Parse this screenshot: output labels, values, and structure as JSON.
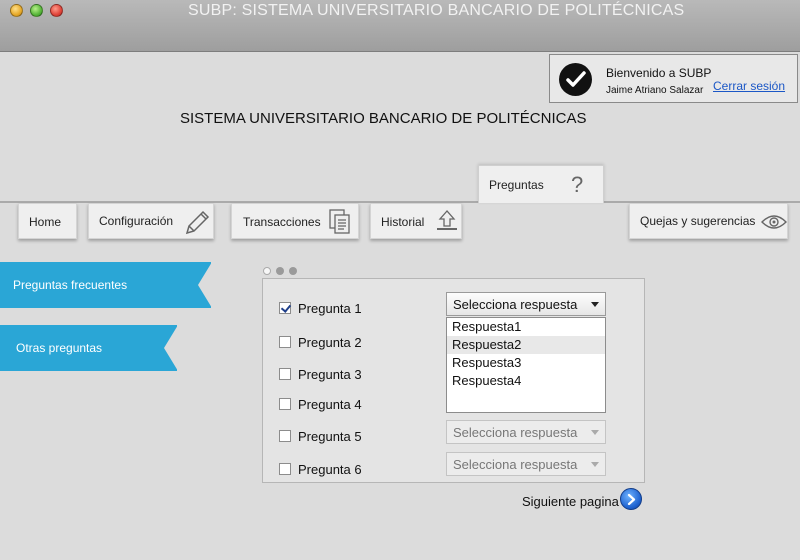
{
  "window": {
    "title": "SUBP: SISTEMA UNIVERSITARIO BANCARIO DE POLITÉCNICAS"
  },
  "welcome": {
    "title": "Bienvenido a SUBP",
    "user": "Jaime Atriano Salazar",
    "logout": "Cerrar sesión"
  },
  "heading": "SISTEMA UNIVERSITARIO BANCARIO DE POLITÉCNICAS",
  "nav": {
    "active_tab": "Preguntas",
    "items": [
      "Home",
      "Configuración",
      "Transacciones",
      "Historial",
      "Quejas y sugerencias"
    ]
  },
  "sidebar": {
    "items": [
      "Preguntas frecuentes",
      "Otras preguntas"
    ]
  },
  "questions": {
    "items": [
      {
        "label": "Pregunta 1",
        "checked": true
      },
      {
        "label": "Pregunta 2",
        "checked": false
      },
      {
        "label": "Pregunta 3",
        "checked": false
      },
      {
        "label": "Pregunta 4",
        "checked": false
      },
      {
        "label": "Pregunta 5",
        "checked": false
      },
      {
        "label": "Pregunta 6",
        "checked": false
      }
    ],
    "select_placeholder": "Selecciona respuesta",
    "dropdown_options": [
      "Respuesta1",
      "Respuesta2",
      "Respuesta3",
      "Respuesta4"
    ],
    "highlighted_option": "Respuesta2"
  },
  "footer": {
    "next_label": "Siguiente pagina"
  },
  "colors": {
    "accent": "#2aa6d6",
    "link": "#1b57c6"
  }
}
